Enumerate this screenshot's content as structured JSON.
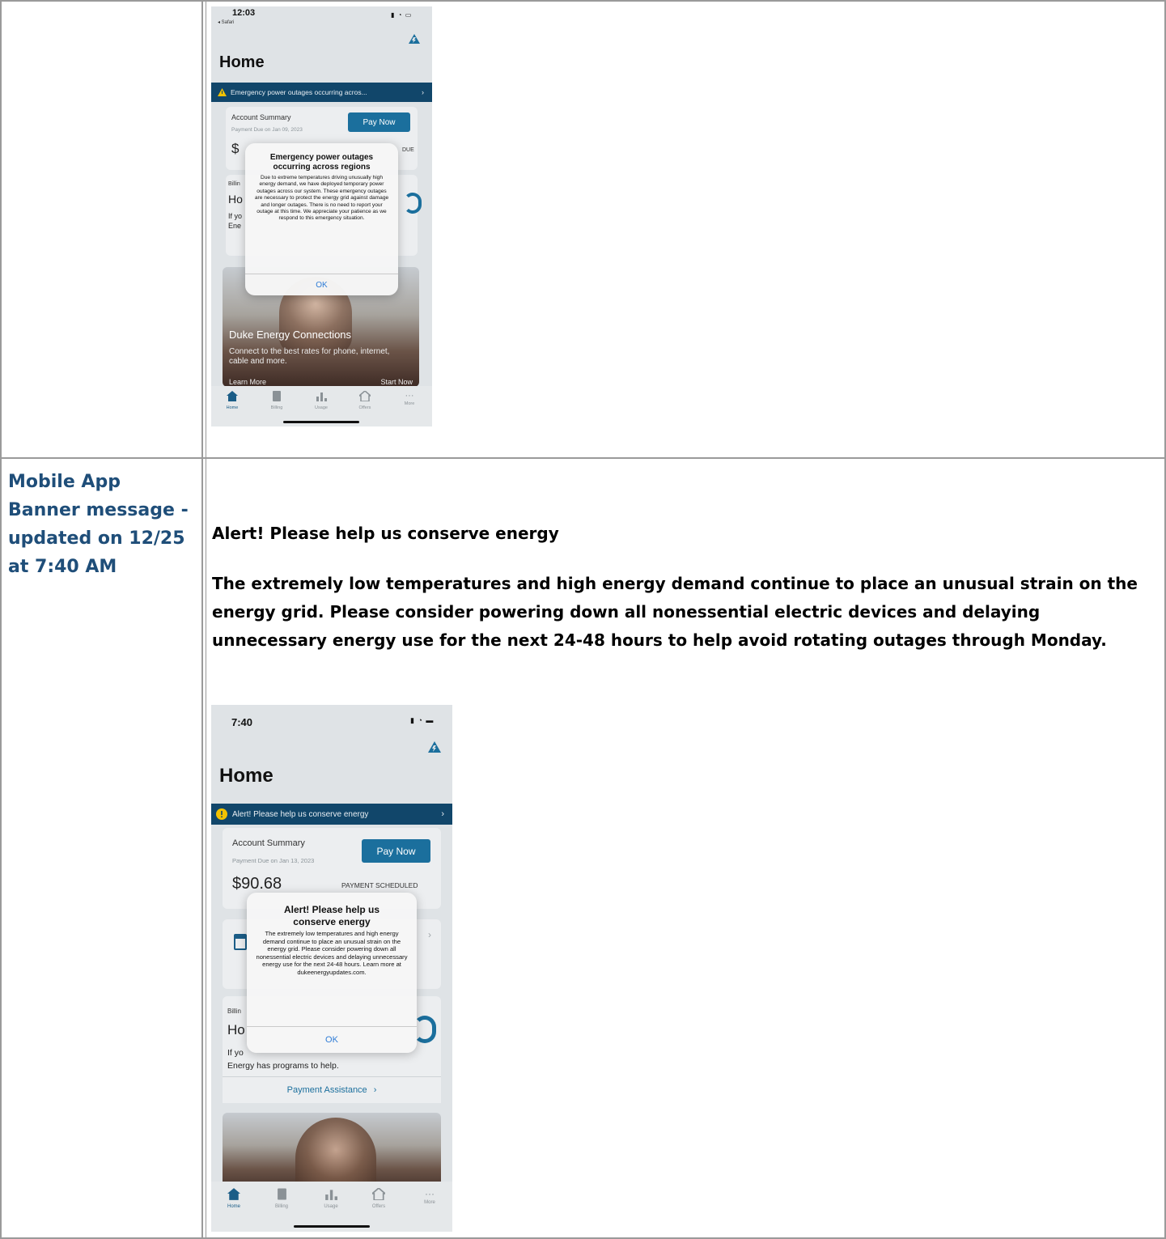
{
  "row_label": "Mobile App Banner message - updated on 12/25 at 7:40 AM",
  "content_title": "Alert! Please help us conserve energy",
  "content_body": "The extremely low temperatures and high energy demand continue to place an unusual strain on the energy grid. Please consider powering down all nonessential electric devices and delaying unnecessary energy use for the next 24-48 hours to help avoid rotating outages through Monday.",
  "screenshot1": {
    "time": "12:03",
    "back_label": "◂ Safari",
    "title": "Home",
    "banner": "Emergency power outages occurring acros...",
    "account_summary": "Account Summary",
    "payment_due": "Payment Due on Jan 09, 2023",
    "pay_now": "Pay Now",
    "amount_partial": "$",
    "status_partial": "DUE",
    "billing_partial": "Billin",
    "ho_partial": "Ho",
    "if_partial": "If yo",
    "ene_partial": "Ene",
    "dialog_title": "Emergency power outages occurring across regions",
    "dialog_body": "Due to extreme temperatures driving unusually high energy demand, we have deployed temporary power outages across our system. These emergency outages are necessary to protect the energy grid against damage and longer outages. There is no need to report your outage at this time. We appreciate your patience as we respond to this emergency situation.",
    "dialog_ok": "OK",
    "promo_title": "Duke Energy Connections",
    "promo_text": "Connect to the best rates for phone, internet, cable and more.",
    "learn_more": "Learn More",
    "start_now": "Start Now",
    "tabs": [
      "Home",
      "Billing",
      "Usage",
      "Offers",
      "More"
    ]
  },
  "screenshot2": {
    "time": "7:40",
    "title": "Home",
    "banner": "Alert! Please help us conserve energy",
    "account_summary": "Account Summary",
    "payment_due": "Payment Due on Jan 13, 2023",
    "pay_now": "Pay Now",
    "amount": "$90.68",
    "status": "PAYMENT SCHEDULED",
    "billing_partial": "Billin",
    "ho_partial": "Ho",
    "if_partial": "If yo",
    "energy_programs": "Energy has programs to help.",
    "payment_assistance": "Payment Assistance",
    "dialog_title": "Alert! Please help us conserve energy",
    "dialog_body": "The extremely low temperatures and high energy demand continue to place an unusual strain on the energy grid. Please consider powering down all nonessential electric devices and delaying unnecessary energy use for the next 24-48 hours. Learn more at dukeenergyupdates.com.",
    "dialog_ok": "OK",
    "tabs": [
      "Home",
      "Billing",
      "Usage",
      "Offers",
      "More"
    ]
  },
  "colors": {
    "label_blue": "#1f4e79",
    "banner_navy": "#11466a",
    "button_blue": "#1b6f9d",
    "warning_yellow": "#f2c200"
  },
  "icons": [
    "warning-triangle-icon",
    "alert-circle-icon",
    "logo-icon",
    "home-icon",
    "billing-icon",
    "usage-icon",
    "offers-icon",
    "more-icon",
    "chevron-right-icon",
    "signal-icon",
    "wifi-icon",
    "battery-icon"
  ]
}
